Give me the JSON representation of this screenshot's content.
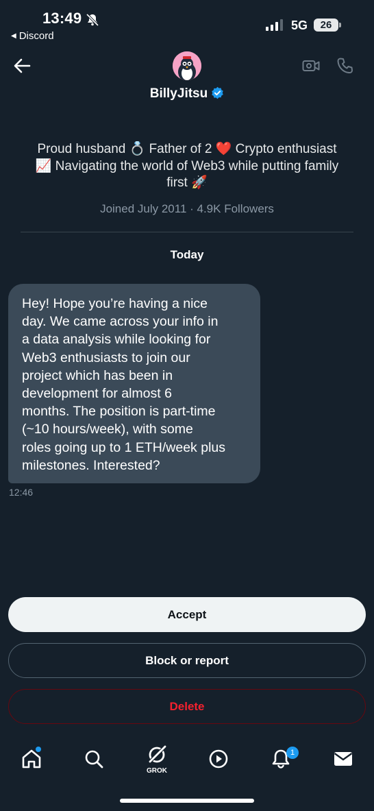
{
  "status_bar": {
    "time": "13:49",
    "back_app": "Discord",
    "network": "5G",
    "battery": "26"
  },
  "header": {
    "name": "BillyJitsu",
    "icons": [
      "back-arrow-icon",
      "video-icon",
      "phone-icon",
      "verified-badge-icon"
    ]
  },
  "profile": {
    "bio_line1": "Proud husband 💍 Father of 2 ❤️ Crypto enthusiast",
    "bio_line2": "📈 Navigating the world of Web3 while putting family",
    "bio_line3": "first 🚀",
    "joined": "Joined July 2011 · 4.9K Followers"
  },
  "conversation": {
    "date_label": "Today",
    "message": {
      "lines": [
        "Hey! Hope you’re having a nice",
        "day. We came across your info in",
        "a data analysis while looking for",
        "Web3 enthusiasts to join our",
        "project which has been in",
        "development for almost 6",
        "months. The position is part-time",
        "(~10 hours/week), with some",
        "roles going up to 1 ETH/week plus",
        "milestones. Interested?"
      ],
      "time": "12:46"
    }
  },
  "actions": {
    "accept": "Accept",
    "block": "Block or report",
    "delete": "Delete"
  },
  "tab_bar": {
    "grok_label": "GROK",
    "notification_count": "1"
  },
  "colors": {
    "background": "#15202b",
    "accent": "#1d9bf0",
    "bubble": "#3b4a58",
    "delete": "#f4212e"
  }
}
